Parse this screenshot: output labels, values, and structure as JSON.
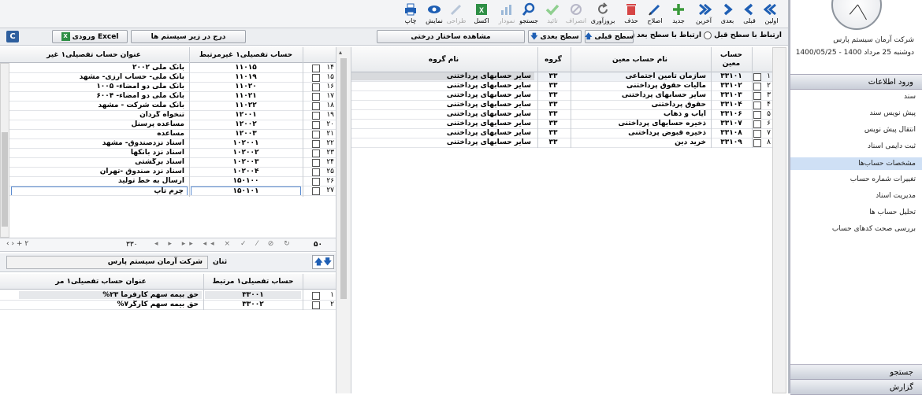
{
  "toolbar": {
    "items": [
      {
        "label": "اولین",
        "icon": "first-icon",
        "enabled": true
      },
      {
        "label": "قبلی",
        "icon": "prev-icon",
        "enabled": true
      },
      {
        "label": "بعدی",
        "icon": "next-icon",
        "enabled": true
      },
      {
        "label": "آخرین",
        "icon": "last-icon",
        "enabled": true
      },
      {
        "label": "جدید",
        "icon": "plus-icon",
        "enabled": true
      },
      {
        "label": "اصلاح",
        "icon": "pencil-icon",
        "enabled": true
      },
      {
        "label": "حذف",
        "icon": "trash-icon",
        "enabled": true
      },
      {
        "label": "بروزآوری",
        "icon": "refresh-icon",
        "enabled": true
      },
      {
        "label": "انصراف",
        "icon": "cancel-icon",
        "enabled": false
      },
      {
        "label": "تائید",
        "icon": "check-icon",
        "enabled": false
      },
      {
        "label": "جستجو",
        "icon": "search-icon",
        "enabled": true
      },
      {
        "label": "نمودار",
        "icon": "chart-icon",
        "enabled": false
      },
      {
        "label": "اکسل",
        "icon": "excel-icon",
        "enabled": true
      },
      {
        "label": "طراحی",
        "icon": "design-icon",
        "enabled": false
      },
      {
        "label": "نمایش",
        "icon": "eye-icon",
        "enabled": true
      },
      {
        "label": "چاپ",
        "icon": "print-icon",
        "enabled": true
      }
    ]
  },
  "sidebar": {
    "company": "شرکت آرمان سیستم پارس",
    "date": "دوشنبه 25 مرداد 1400 - 1400/05/25",
    "section_header": "ورود اطلاعات",
    "items": [
      "سند",
      "پیش نویس سند",
      "انتقال پیش نویس",
      "ثبت دایمی اسناد",
      "مشخصات حساب‌ها",
      "تغییرات شماره حساب",
      "مدیریت اسناد",
      "تحلیل حساب ها",
      "بررسی صحت کدهای حساب"
    ],
    "active_index": 4,
    "bottom_headers": [
      "جستجو",
      "گزارش"
    ]
  },
  "nav_bar": {
    "radio_prev": "ارتباط با سطح قبل",
    "radio_next": "ارتباط با سطح بعد",
    "btn_prev_level": "سطح قبلی",
    "btn_next_level": "سطح بعدی",
    "btn_tree": "مشاهده ساختار درختی",
    "btn_insert": "درج در زیر سیستم ها",
    "btn_excel": "ورودی Excel"
  },
  "main_table": {
    "headers": {
      "account": "حساب معین",
      "account_name": "نام حساب معین",
      "group": "گروه",
      "group_name": "نام گروه"
    },
    "rows": [
      {
        "n": "۱",
        "code": "۳۳۱۰۱",
        "name": "سازمان تامین اجتماعی",
        "group": "۳۳",
        "group_name": "سایر حسابهای پرداختنی"
      },
      {
        "n": "۲",
        "code": "۳۳۱۰۲",
        "name": "مالیات حقوق پرداختنی",
        "group": "۳۳",
        "group_name": "سایر حسابهای پرداختنی"
      },
      {
        "n": "۳",
        "code": "۳۳۱۰۳",
        "name": "سایر حسابهای پرداختنی",
        "group": "۳۳",
        "group_name": "سایر حسابهای پرداختنی"
      },
      {
        "n": "۴",
        "code": "۳۳۱۰۴",
        "name": "حقوق پرداختنی",
        "group": "۳۳",
        "group_name": "سایر حسابهای پرداختنی"
      },
      {
        "n": "۵",
        "code": "۳۳۱۰۶",
        "name": "ایاب و ذهاب",
        "group": "۳۳",
        "group_name": "سایر حسابهای پرداختنی"
      },
      {
        "n": "۶",
        "code": "۳۳۱۰۷",
        "name": "ذخیره حسابهای پرداختنی",
        "group": "۳۳",
        "group_name": "سایر حسابهای پرداختنی"
      },
      {
        "n": "۷",
        "code": "۳۳۱۰۸",
        "name": "ذخیره قبوض پرداختنی",
        "group": "۳۳",
        "group_name": "سایر حسابهای پرداختنی"
      },
      {
        "n": "۸",
        "code": "۳۳۱۰۹",
        "name": "خرید دین",
        "group": "۳۳",
        "group_name": "سایر حسابهای پرداختنی"
      }
    ]
  },
  "detail_table": {
    "headers": {
      "code": "حساب تفصیلی۱ غیرمرتبط",
      "title": "عنوان حساب تفصیلی۱ غیر"
    },
    "rows": [
      {
        "n": "۱۴",
        "code": "۱۱۰۱۵",
        "title": "بانک ملی ۲۰۰۲"
      },
      {
        "n": "۱۵",
        "code": "۱۱۰۱۹",
        "title": "بانک ملی- حساب ارزی- مشهد"
      },
      {
        "n": "۱۶",
        "code": "۱۱۰۲۰",
        "title": "بانک ملی دو امضاء- ۱۰۰۵"
      },
      {
        "n": "۱۷",
        "code": "۱۱۰۲۱",
        "title": "بانک ملی دو امضاء- ۶۰۰۴"
      },
      {
        "n": "۱۸",
        "code": "۱۱۰۲۲",
        "title": "بانک ملت شرکت - مشهد"
      },
      {
        "n": "۱۹",
        "code": "۱۲۰۰۱",
        "title": "تنخواه گردان"
      },
      {
        "n": "۲۰",
        "code": "۱۲۰۰۲",
        "title": "مساعده پرسنل"
      },
      {
        "n": "۲۱",
        "code": "۱۲۰۰۳",
        "title": "مساعده"
      },
      {
        "n": "۲۲",
        "code": "۱۰۲۰۰۱",
        "title": "اسناد نزدصندوق- مشهد"
      },
      {
        "n": "۲۳",
        "code": "۱۰۲۰۰۲",
        "title": "اسناد نزد بانکها"
      },
      {
        "n": "۲۴",
        "code": "۱۰۲۰۰۳",
        "title": "اسناد برگشتی"
      },
      {
        "n": "۲۵",
        "code": "۱۰۲۰۰۴",
        "title": "اسناد نزد صندوق -تهران"
      },
      {
        "n": "۲۶",
        "code": "۱۵۰۱۰۰",
        "title": "ارسال به خط تولید"
      },
      {
        "n": "۲۷",
        "code": "۱۵۰۱۰۱",
        "title": "چرم تاپ"
      }
    ],
    "footer_count": "۵۰",
    "nav_value": "۳۳۰"
  },
  "mid_bar": {
    "label": "ثنان",
    "value": "شرکت آرمان سیستم پارس"
  },
  "related_table": {
    "headers": {
      "code": "حساب تفصیلی۱ مرتبط",
      "title": "عنوان حساب تفصیلی۱ مر"
    },
    "rows": [
      {
        "n": "۱",
        "code": "۳۳۰۰۱",
        "title": "حق بیمه سهم کارفرما ۲۳%"
      },
      {
        "n": "۲",
        "code": "۳۳۰۰۲",
        "title": "حق بیمه سهم کارگر۷%"
      }
    ]
  }
}
